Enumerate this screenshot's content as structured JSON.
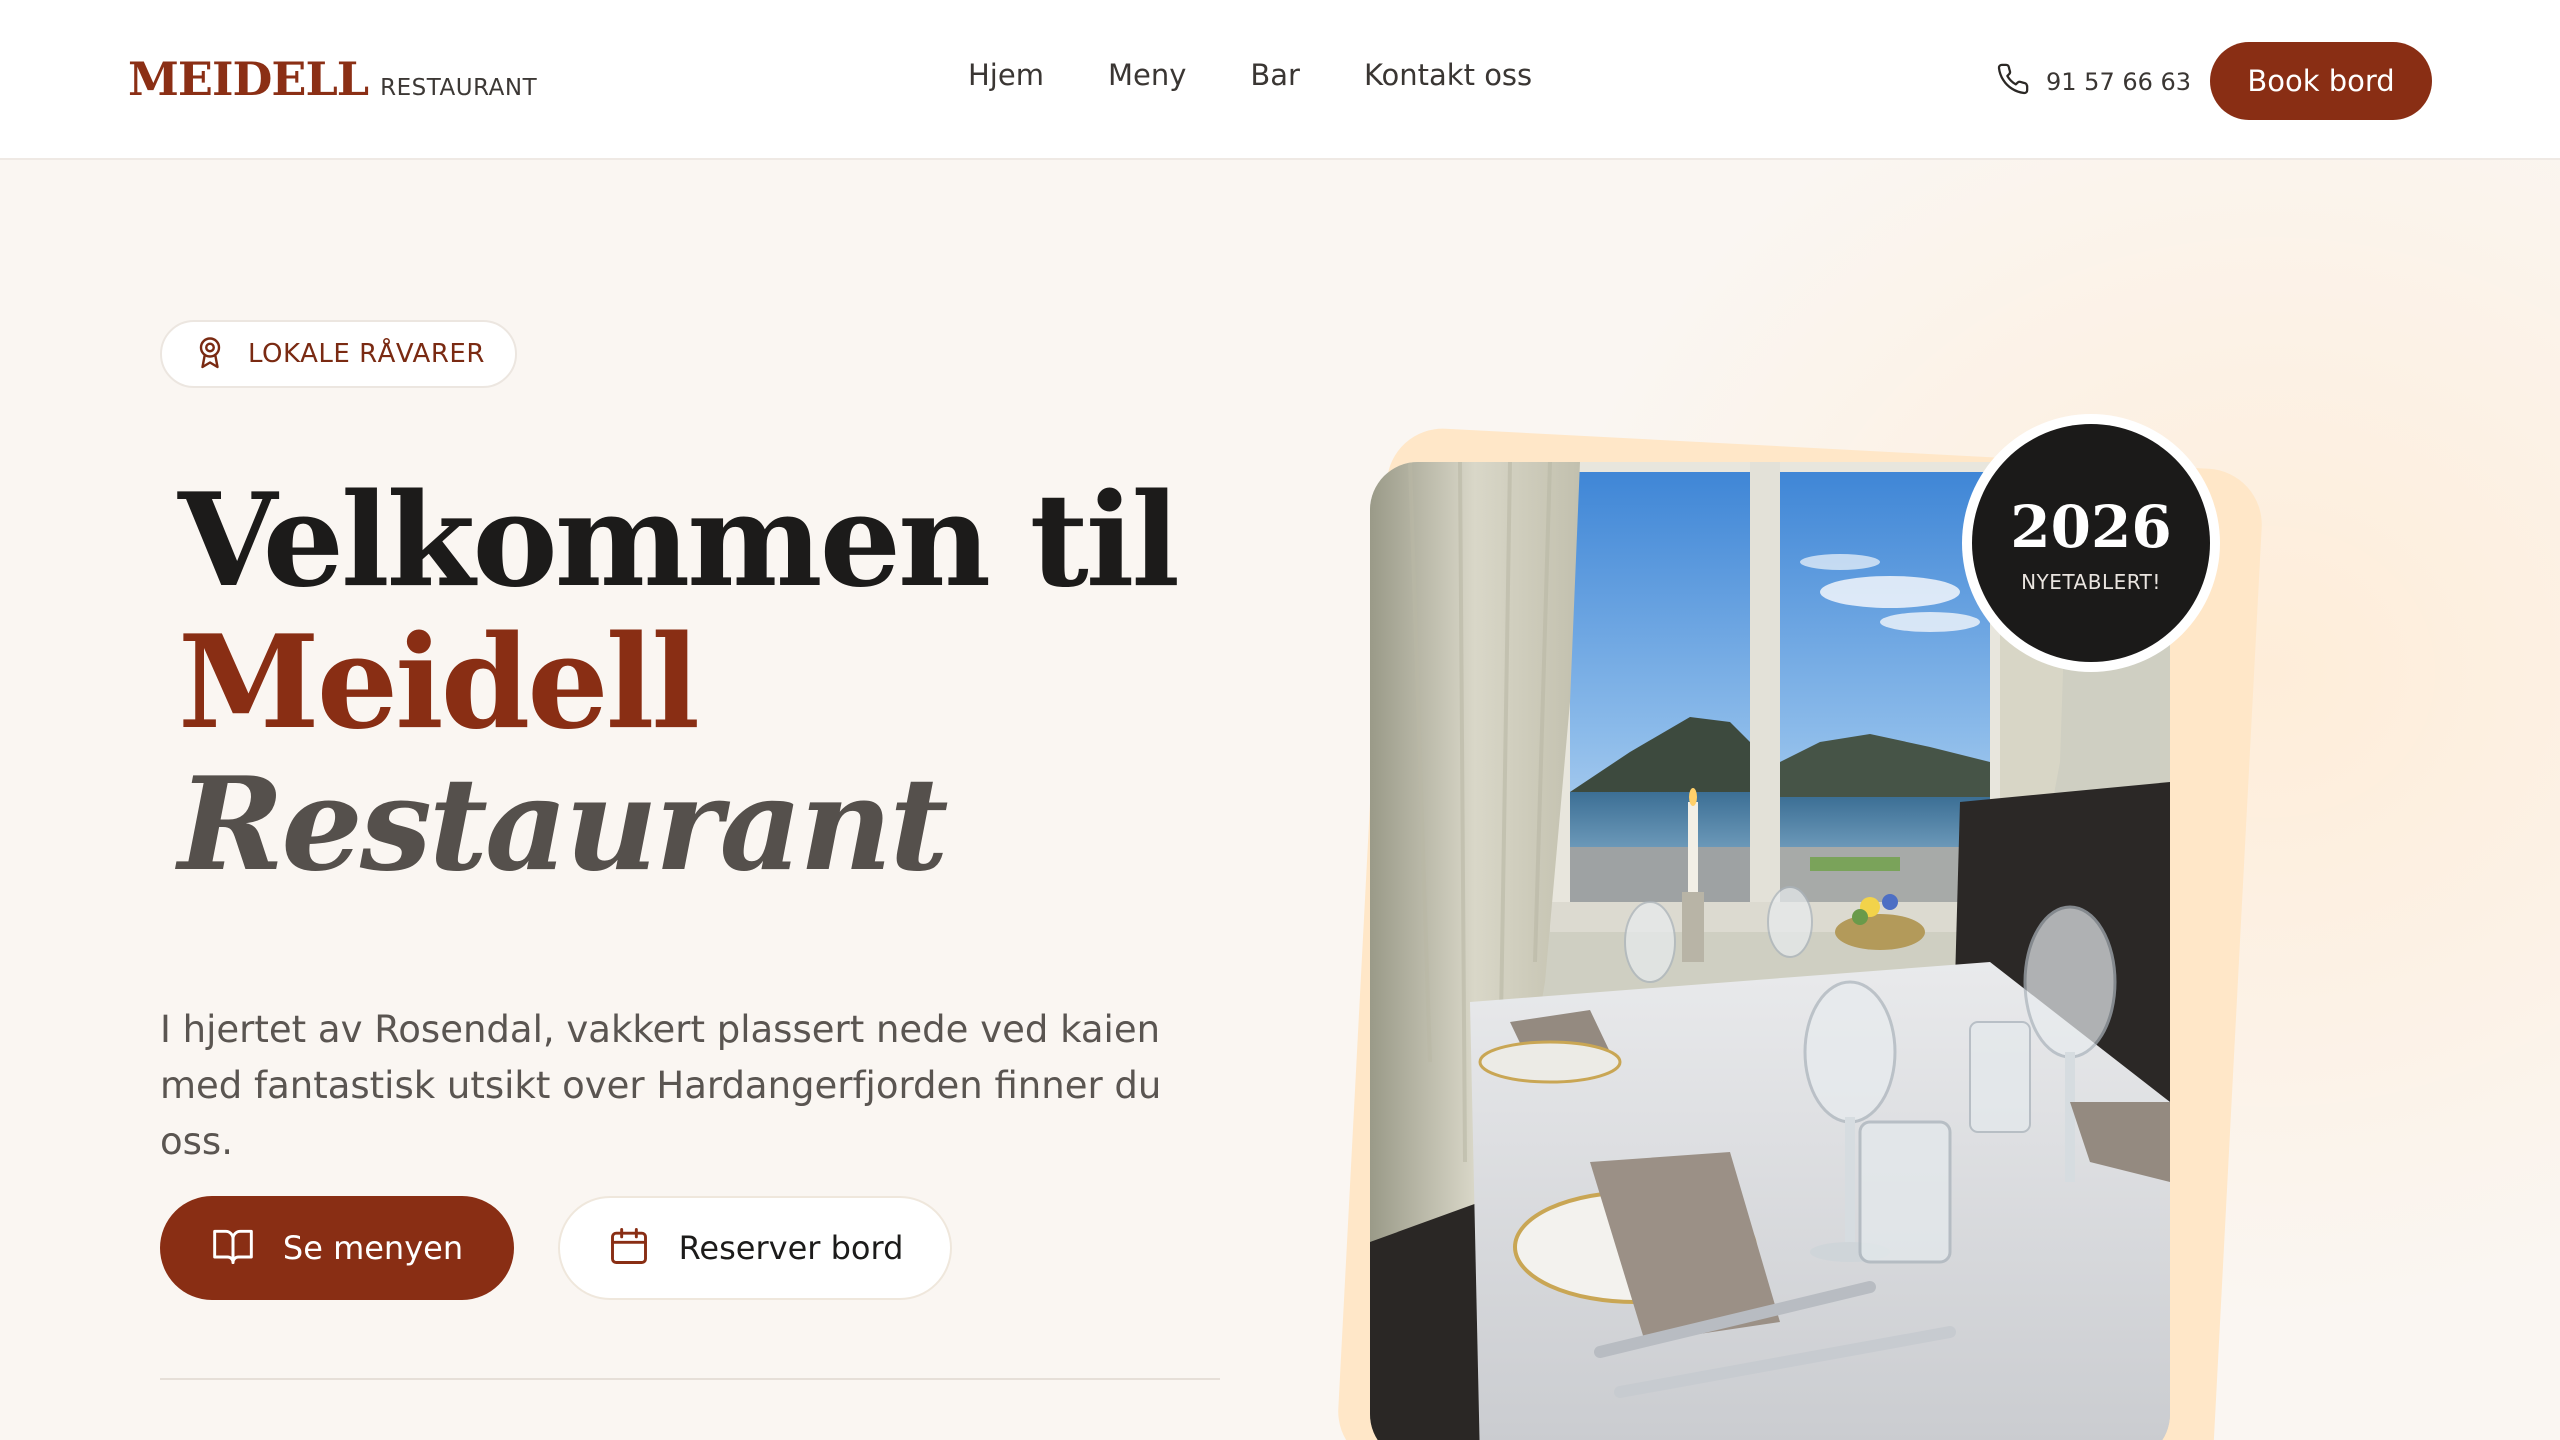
{
  "header": {
    "logo_word": "MEIDELL",
    "logo_sub": "RESTAURANT",
    "nav": [
      {
        "label": "Hjem"
      },
      {
        "label": "Meny"
      },
      {
        "label": "Bar"
      },
      {
        "label": "Kontakt oss"
      }
    ],
    "phone": "91 57 66 63",
    "book_label": "Book bord"
  },
  "hero": {
    "badge": "LOKALE RÅVARER",
    "headline_1": "Velkommen til",
    "headline_2": "Meidell",
    "headline_3": "Restaurant",
    "lead": "I hjertet av Rosendal, vakkert plassert nede ved kaien med fantastisk utsikt over Hardangerfjorden finner du oss.",
    "primary_button": "Se menyen",
    "secondary_button": "Reserver bord"
  },
  "year_badge": {
    "year": "2026",
    "label": "NYETABLERT!"
  },
  "colors": {
    "accent": "#892e14",
    "background": "#faf6f2",
    "dark": "#1b1a19"
  },
  "icons": {
    "phone": "phone-icon",
    "badge": "award-icon",
    "menu": "book-open-icon",
    "reserve": "calendar-icon"
  }
}
